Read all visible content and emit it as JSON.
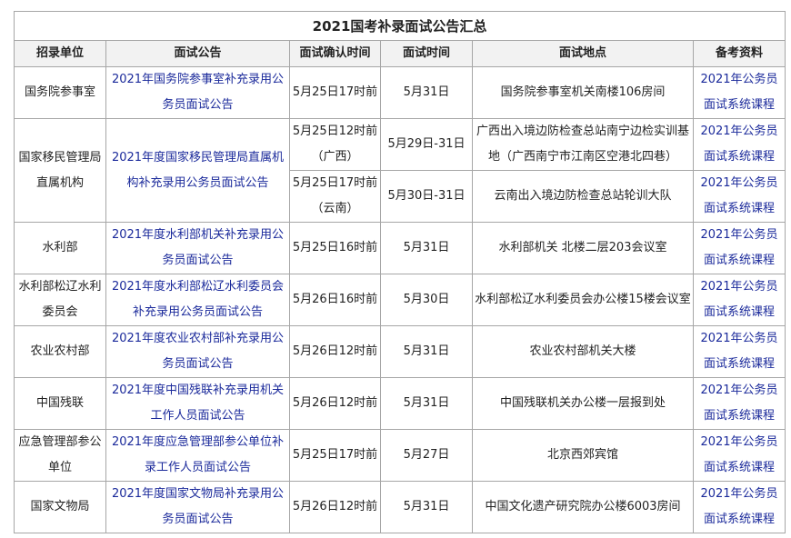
{
  "title": "2021国考补录面试公告汇总",
  "headers": [
    "招录单位",
    "面试公告",
    "面试确认时间",
    "面试时间",
    "面试地点",
    "备考资料"
  ],
  "course_link": "2021年公务员面试系统课程",
  "rows": [
    {
      "unit": "国务院参事室",
      "notice": "2021年国务院参事室补充录用公务员面试公告",
      "confirm": "5月25日17时前",
      "date": "5月31日",
      "place": "国务院参事室机关南楼106房间"
    },
    {
      "unit": "国家移民管理局直属机构",
      "notice": "2021年度国家移民管理局直属机构补充录用公务员面试公告",
      "confirm": "5月25日12时前（广西）",
      "date": "5月29日-31日",
      "place": "广西出入境边防检查总站南宁边检实训基地（广西南宁市江南区空港北四巷）",
      "confirm2": "5月25日17时前（云南）",
      "date2": "5月30日-31日",
      "place2": "云南出入境边防检查总站轮训大队"
    },
    {
      "unit": "水利部",
      "notice": "2021年度水利部机关补充录用公务员面试公告",
      "confirm": "5月25日16时前",
      "date": "5月31日",
      "place": "水利部机关 北楼二层203会议室"
    },
    {
      "unit": "水利部松辽水利委员会",
      "notice": "2021年度水利部松辽水利委员会补充录用公务员面试公告",
      "confirm": "5月26日16时前",
      "date": "5月30日",
      "place": "水利部松辽水利委员会办公楼15楼会议室"
    },
    {
      "unit": "农业农村部",
      "notice": "2021年度农业农村部补充录用公务员面试公告",
      "confirm": "5月26日12时前",
      "date": "5月31日",
      "place": "农业农村部机关大楼"
    },
    {
      "unit": "中国残联",
      "notice": "2021年度中国残联补充录用机关工作人员面试公告",
      "confirm": "5月26日12时前",
      "date": "5月31日",
      "place": "中国残联机关办公楼一层报到处"
    },
    {
      "unit": "应急管理部参公单位",
      "notice": "2021年度应急管理部参公单位补录工作人员面试公告",
      "confirm": "5月25日17时前",
      "date": "5月27日",
      "place": "北京西郊宾馆"
    },
    {
      "unit": "国家文物局",
      "notice": "2021年度国家文物局补充录用公务员面试公告",
      "confirm": "5月26日12时前",
      "date": "5月31日",
      "place": "中国文化遗产研究院办公楼6003房间"
    }
  ]
}
